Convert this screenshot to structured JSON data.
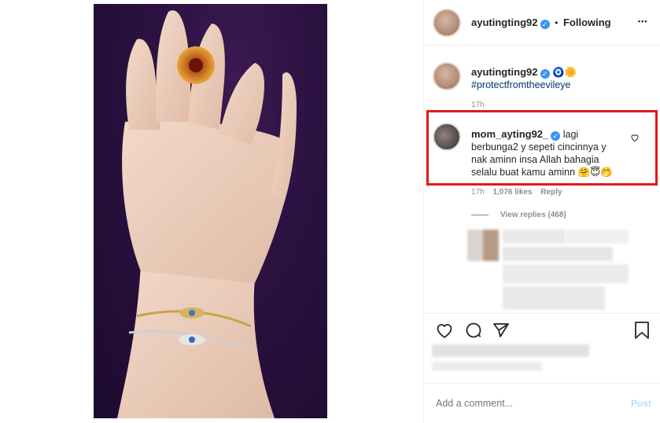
{
  "header": {
    "username": "ayutingting92",
    "separator": "•",
    "follow_status": "Following",
    "more_label": "•••"
  },
  "caption": {
    "username": "ayutingting92",
    "emojis": "🧿🌼",
    "hashtag": "#protectfromtheevileye",
    "time": "17h"
  },
  "highlighted_comment": {
    "username": "mom_ayting92_",
    "text_line1": "lagi",
    "text_line2": "berbunga2 y sepeti cincinnya y",
    "text_line3": "nak aminn insa Allah bahagia",
    "text_line4": "selalu buat kamu aminn",
    "emojis": "🤗😇🤭",
    "time": "17h",
    "likes": "1,076 likes",
    "reply_label": "Reply"
  },
  "view_replies": "View replies (468)",
  "comment_box": {
    "placeholder": "Add a comment...",
    "post_label": "Post"
  },
  "colors": {
    "verified": "#3897f0",
    "highlight_border": "#e0191c",
    "hashtag": "#00376b",
    "post_disabled": "#b2dffc"
  }
}
